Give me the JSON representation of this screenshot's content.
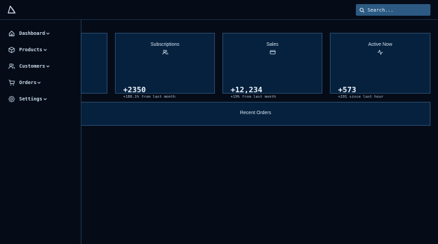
{
  "search": {
    "placeholder": "Search..."
  },
  "sidebar": {
    "items": [
      {
        "label": "Dashboard",
        "icon": "home-icon"
      },
      {
        "label": "Products",
        "icon": "box-icon"
      },
      {
        "label": "Customers",
        "icon": "users-icon"
      },
      {
        "label": "Orders",
        "icon": "cart-icon"
      },
      {
        "label": "Settings",
        "icon": "gear-icon"
      }
    ]
  },
  "cards": [
    {
      "title": "Subscriptions",
      "icon": "users-icon",
      "value": "+2350",
      "sub": "+180.1% from last month"
    },
    {
      "title": "Sales",
      "icon": "credit-card-icon",
      "value": "+12,234",
      "sub": "+19% from last month"
    },
    {
      "title": "Active Now",
      "icon": "activity-icon",
      "value": "+573",
      "sub": "+201 since last hour"
    }
  ],
  "recent_orders": {
    "title": "Recent Orders"
  },
  "colors": {
    "background": "#050c18",
    "card": "#06213e",
    "card_border": "#2a4a6c",
    "search": "#2c5a82"
  }
}
